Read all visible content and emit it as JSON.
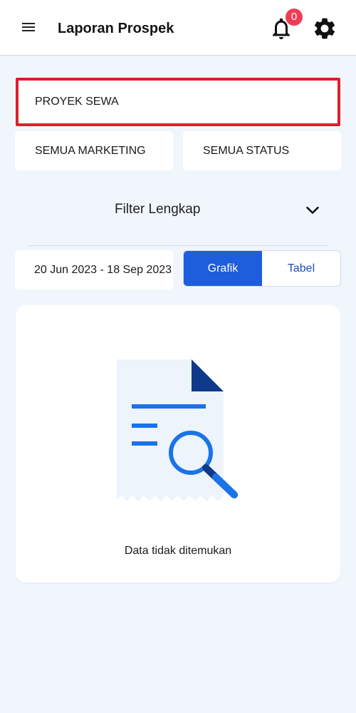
{
  "header": {
    "title": "Laporan Prospek",
    "notification_count": "0"
  },
  "filters": {
    "project": "PROYEK SEWA",
    "marketing": "SEMUA MARKETING",
    "status": "SEMUA STATUS",
    "advanced_label": "Filter Lengkap"
  },
  "date_range": "20 Jun 2023 - 18 Sep 2023",
  "view_toggle": {
    "chart_label": "Grafik",
    "table_label": "Tabel",
    "selected": "Grafik"
  },
  "empty_state": {
    "message": "Data tidak ditemukan"
  },
  "colors": {
    "accent": "#1e5ddc",
    "badge": "#ee3d55",
    "highlight_border": "#e01c2c",
    "background": "#f1f6fd"
  },
  "icons": {
    "menu": "hamburger-menu-icon",
    "notifications": "bell-icon",
    "settings": "gear-icon",
    "expand": "chevron-down-icon",
    "empty": "document-search-illustration"
  }
}
